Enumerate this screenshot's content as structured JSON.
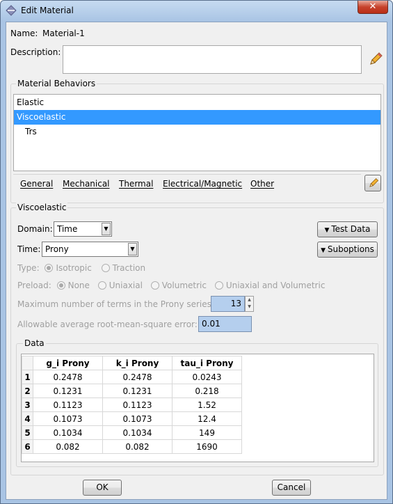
{
  "window": {
    "title": "Edit Material",
    "close_glyph": "✕"
  },
  "name": {
    "label": "Name:",
    "value": "Material-1"
  },
  "description": {
    "label": "Description:",
    "value": ""
  },
  "behaviors": {
    "title": "Material Behaviors",
    "items": [
      {
        "label": "Elastic",
        "selected": false,
        "indent": 0
      },
      {
        "label": "Viscoelastic",
        "selected": true,
        "indent": 0
      },
      {
        "label": "Trs",
        "selected": false,
        "indent": 1
      }
    ]
  },
  "menu": {
    "items": [
      "General",
      "Mechanical",
      "Thermal",
      "Electrical/Magnetic",
      "Other"
    ]
  },
  "viscoelastic": {
    "title": "Viscoelastic",
    "domain": {
      "label": "Domain:",
      "value": "Time"
    },
    "time": {
      "label": "Time:",
      "value": "Prony"
    },
    "test_data_button": "Test Data",
    "suboptions_button": "Suboptions",
    "type": {
      "label": "Type:",
      "options": [
        "Isotropic",
        "Traction"
      ],
      "selected": "Isotropic"
    },
    "preload": {
      "label": "Preload:",
      "options": [
        "None",
        "Uniaxial",
        "Volumetric",
        "Uniaxial and Volumetric"
      ],
      "selected": "None"
    },
    "max_terms": {
      "label": "Maximum number of terms in the Prony series:",
      "value": "13"
    },
    "rms_error": {
      "label": "Allowable average root-mean-square error:",
      "value": "0.01"
    }
  },
  "data": {
    "title": "Data",
    "columns": [
      "g_i Prony",
      "k_i Prony",
      "tau_i Prony"
    ],
    "rows": [
      {
        "n": "1",
        "cells": [
          "0.2478",
          "0.2478",
          "0.0243"
        ]
      },
      {
        "n": "2",
        "cells": [
          "0.1231",
          "0.1231",
          "0.218"
        ]
      },
      {
        "n": "3",
        "cells": [
          "0.1123",
          "0.1123",
          "1.52"
        ]
      },
      {
        "n": "4",
        "cells": [
          "0.1073",
          "0.1073",
          "12.4"
        ]
      },
      {
        "n": "5",
        "cells": [
          "0.1034",
          "0.1034",
          "149"
        ]
      },
      {
        "n": "6",
        "cells": [
          "0.082",
          "0.082",
          "1690"
        ]
      }
    ]
  },
  "buttons": {
    "ok": "OK",
    "cancel": "Cancel"
  },
  "colors": {
    "selection": "#3399ff",
    "title_bar": "#a9c4e4",
    "input_highlight": "#b5cfee"
  }
}
